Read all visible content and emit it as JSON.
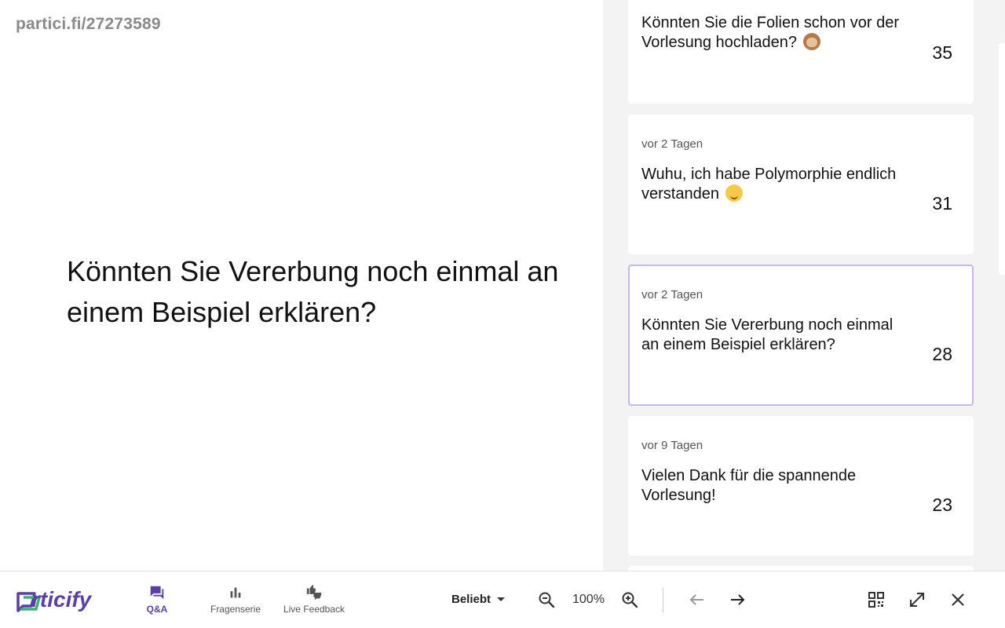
{
  "session": {
    "url": "partici.fi/27273589"
  },
  "presentation": {
    "current_question": "Könnten Sie Vererbung noch einmal an einem Beispiel erklären?"
  },
  "questions": [
    {
      "time": "",
      "text": "Könnten Sie die Folien schon vor der Vorlesung hochladen?",
      "emoji": "monkey",
      "votes": "35"
    },
    {
      "time": "vor 2 Tagen",
      "text": "Wuhu, ich habe Polymorphie endlich verstanden",
      "emoji": "smile",
      "votes": "31"
    },
    {
      "time": "vor 2 Tagen",
      "text": "Könnten Sie Vererbung noch einmal an einem Beispiel erklären?",
      "emoji": "",
      "votes": "28",
      "active": true
    },
    {
      "time": "vor 9 Tagen",
      "text": "Vielen Dank für die spannende Vorlesung!",
      "emoji": "",
      "votes": "23"
    }
  ],
  "toolbar": {
    "brand": "rticify",
    "nav": [
      {
        "label": "Q&A",
        "icon": "forum-icon",
        "active": true
      },
      {
        "label": "Fragenserie",
        "icon": "bar-chart-icon",
        "active": false
      },
      {
        "label": "Live Feedback",
        "icon": "thumbs-icon",
        "active": false
      }
    ],
    "sort_label": "Beliebt",
    "zoom_value": "100%"
  },
  "colors": {
    "accent": "#5a3fa8",
    "active_border": "#c9b6ef",
    "panel_bg": "#f3f3f3"
  }
}
